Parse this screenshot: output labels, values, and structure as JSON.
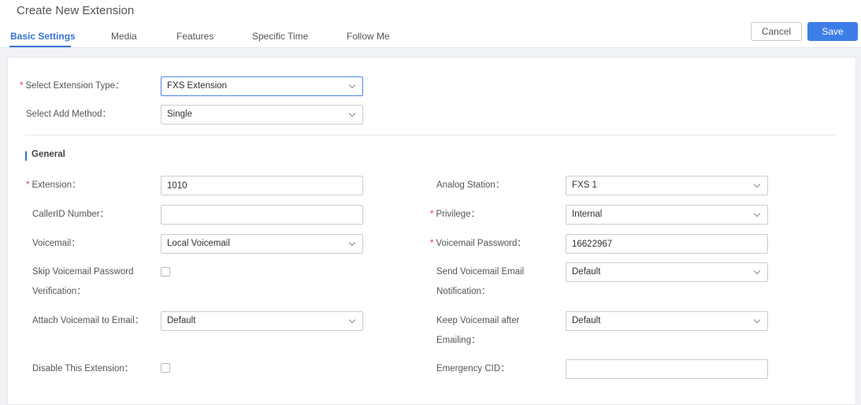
{
  "header": {
    "title": "Create New Extension",
    "tabs": [
      {
        "label": "Basic Settings",
        "active": true
      },
      {
        "label": "Media",
        "active": false
      },
      {
        "label": "Features",
        "active": false
      },
      {
        "label": "Specific Time",
        "active": false
      },
      {
        "label": "Follow Me",
        "active": false
      }
    ],
    "cancel_label": "Cancel",
    "save_label": "Save"
  },
  "form": {
    "extension_type": {
      "label": "Select Extension Type",
      "value": "FXS Extension",
      "required": true
    },
    "add_method": {
      "label": "Select Add Method",
      "value": "Single"
    },
    "section_title": "General",
    "extension": {
      "label": "Extension",
      "value": "1010",
      "required": true
    },
    "callerid_number": {
      "label": "CallerID Number",
      "value": ""
    },
    "voicemail": {
      "label": "Voicemail",
      "value": "Local Voicemail"
    },
    "skip_vm_password": {
      "label_line1": "Skip Voicemail Password",
      "label_line2": "Verification",
      "checked": false
    },
    "attach_vm_email": {
      "label": "Attach Voicemail to Email",
      "value": "Default"
    },
    "disable_extension": {
      "label": "Disable This Extension",
      "checked": false
    },
    "analog_station": {
      "label": "Analog Station",
      "value": "FXS 1"
    },
    "privilege": {
      "label": "Privilege",
      "value": "Internal",
      "required": true
    },
    "voicemail_password": {
      "label": "Voicemail Password",
      "value": "16622967",
      "required": true
    },
    "send_vm_email_notification": {
      "label_line1": "Send Voicemail Email",
      "label_line2": "Notification",
      "value": "Default"
    },
    "keep_vm_after_emailing": {
      "label_line1": "Keep Voicemail after",
      "label_line2": "Emailing",
      "value": "Default"
    },
    "emergency_cid": {
      "label": "Emergency CID",
      "value": ""
    }
  },
  "colors": {
    "accent": "#3a73d6",
    "save_button": "#3d7de8",
    "required": "#e0393e"
  }
}
